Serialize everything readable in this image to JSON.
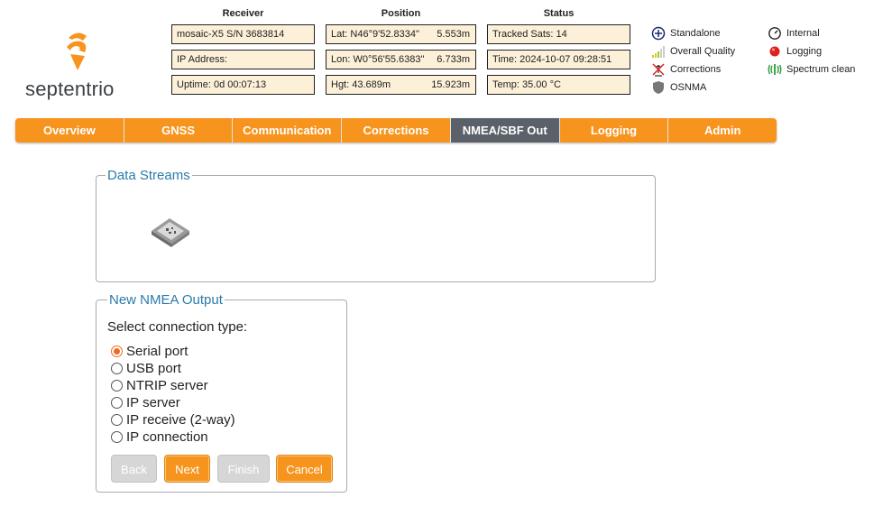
{
  "brand": {
    "name": "septentrio"
  },
  "header": {
    "receiver_title": "Receiver",
    "position_title": "Position",
    "status_title": "Status"
  },
  "receiver": {
    "model": "mosaic-X5 S/N 3683814",
    "ip": "IP Address:",
    "uptime": "Uptime: 0d 00:07:13"
  },
  "position": {
    "lat": "Lat:  N46°9'52.8334\"",
    "lat_acc": "5.553m",
    "lon": "Lon: W0°56'55.6383\"",
    "lon_acc": "6.733m",
    "hgt": "Hgt:  43.689m",
    "hgt_acc": "15.923m"
  },
  "status": {
    "tracked": "Tracked Sats: 14",
    "time": "Time: 2024-10-07 09:28:51",
    "temp": "Temp: 35.00 °C"
  },
  "indicators": {
    "standalone": "Standalone",
    "quality": "Overall Quality",
    "corrections": "Corrections",
    "osnma": "OSNMA",
    "internal": "Internal",
    "logging": "Logging",
    "spectrum": "Spectrum clean"
  },
  "nav": {
    "tabs": [
      "Overview",
      "GNSS",
      "Communication",
      "Corrections",
      "NMEA/SBF Out",
      "Logging",
      "Admin"
    ],
    "active": "NMEA/SBF Out"
  },
  "data_streams": {
    "legend": "Data Streams"
  },
  "new_output": {
    "legend": "New NMEA Output",
    "prompt": "Select connection type:",
    "options": [
      "Serial port",
      "USB port",
      "NTRIP server",
      "IP server",
      "IP receive (2-way)",
      "IP connection"
    ],
    "selected": "Serial port"
  },
  "buttons": {
    "back": "Back",
    "next": "Next",
    "finish": "Finish",
    "cancel": "Cancel"
  },
  "colors": {
    "accent": "#f7941d",
    "active_tab": "#5a6169",
    "legend": "#2a7bab",
    "info_bg": "#fdf0d8"
  }
}
